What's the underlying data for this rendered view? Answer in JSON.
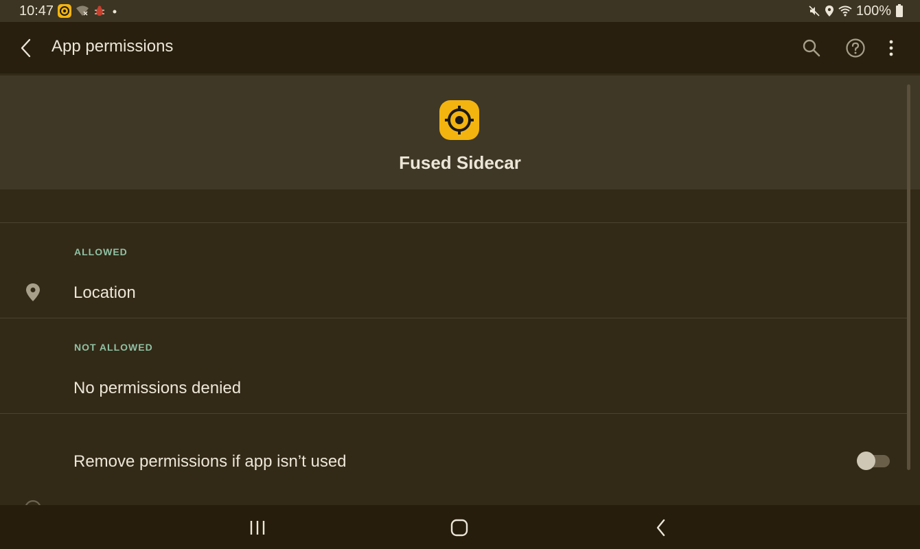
{
  "status_bar": {
    "time": "10:47",
    "battery": "100%",
    "icons_left": [
      "fused-sidecar-notification-icon",
      "wifi-x-icon",
      "bug-icon",
      "dot-icon"
    ],
    "icons_right": [
      "mute-icon",
      "location-icon",
      "wifi-icon",
      "battery-icon"
    ]
  },
  "app_bar": {
    "title": "App permissions",
    "actions": [
      "search-icon",
      "help-icon",
      "more-vert-icon"
    ]
  },
  "app_header": {
    "name": "Fused Sidecar",
    "icon": "target-icon",
    "icon_color": "#F3B40F"
  },
  "sections": {
    "allowed": {
      "label": "ALLOWED",
      "items": [
        {
          "label": "Location",
          "icon": "location-pin-icon"
        }
      ]
    },
    "not_allowed": {
      "label": "NOT ALLOWED",
      "items": [
        {
          "label": "No permissions denied"
        }
      ]
    }
  },
  "remove_permissions": {
    "label": "Remove permissions if app isn’t used",
    "enabled": false
  },
  "nav_bar": {
    "buttons": [
      "recents-icon",
      "home-icon",
      "back-icon"
    ]
  },
  "colors": {
    "accent": "#8FC2A4",
    "background": "#332917",
    "app_bar": "#281F0E",
    "header_card": "#3F3826"
  }
}
